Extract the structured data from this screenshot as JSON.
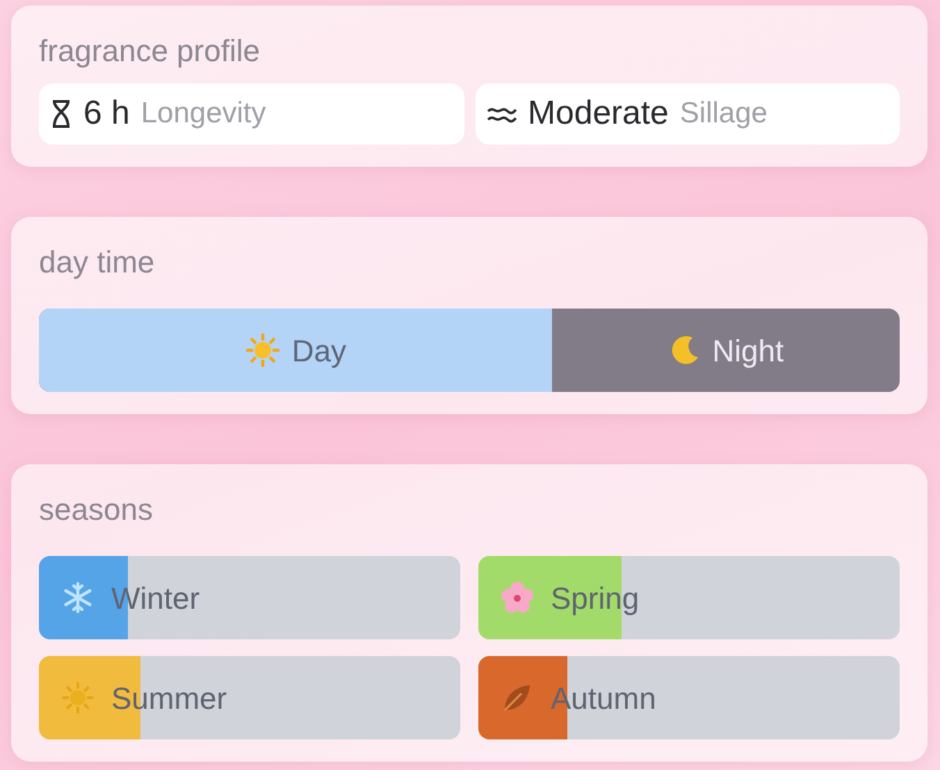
{
  "fragrance_profile": {
    "title": "fragrance profile",
    "stats": [
      {
        "kind": "longevity",
        "value": "6 h",
        "label": "Longevity"
      },
      {
        "kind": "sillage",
        "value": "Moderate",
        "label": "Sillage"
      }
    ]
  },
  "day_time": {
    "title": "day time",
    "level": 0.596,
    "day": "Day",
    "night": "Night"
  },
  "seasons": {
    "title": "seasons",
    "items": [
      {
        "kind": "winter",
        "label": "Winter",
        "level": 0.21,
        "color": "#56a4e8"
      },
      {
        "kind": "spring",
        "label": "Spring",
        "level": 0.34,
        "color": "#a3db6a"
      },
      {
        "kind": "summer",
        "label": "Summer",
        "level": 0.24,
        "color": "#f1bb3e"
      },
      {
        "kind": "autumn",
        "label": "Autumn",
        "level": 0.21,
        "color": "#d9682c"
      }
    ]
  }
}
